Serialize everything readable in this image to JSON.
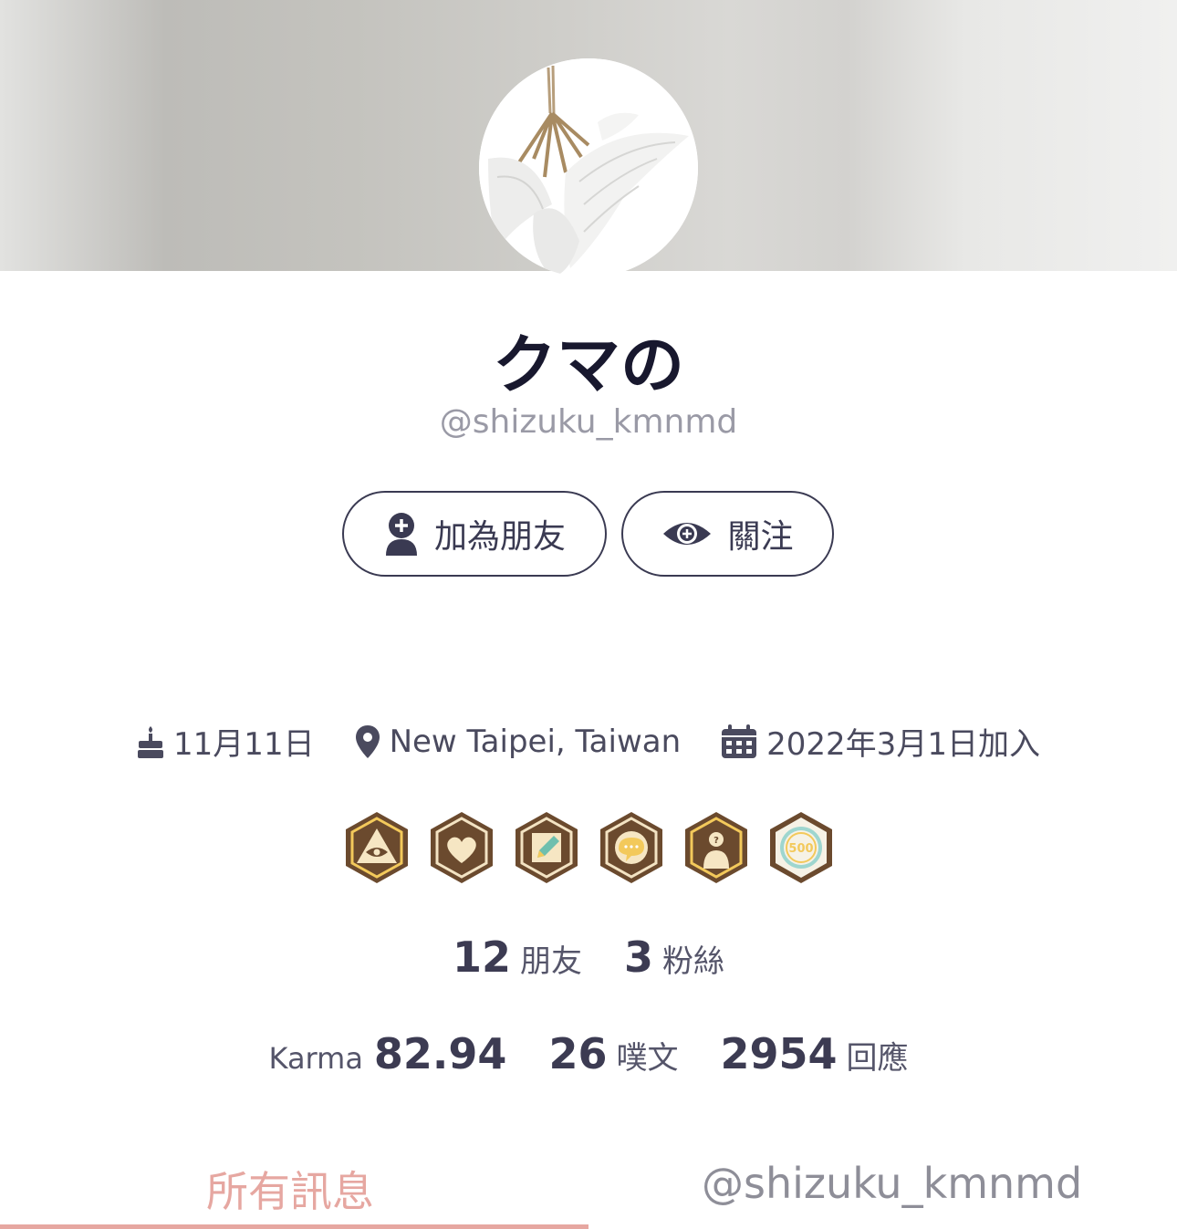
{
  "profile": {
    "display_name": "クマの",
    "handle": "@shizuku_kmnmd"
  },
  "actions": {
    "add_friend_label": "加為朋友",
    "follow_label": "關注"
  },
  "meta": {
    "birthday": "11月11日",
    "location": "New Taipei, Taiwan",
    "joined": "2022年3月1日加入"
  },
  "badges": [
    {
      "name": "eye-triangle-badge",
      "ring": "#f3c95b"
    },
    {
      "name": "heart-badge",
      "ring": "#f3e3c3"
    },
    {
      "name": "pencil-badge",
      "ring": "#f3e3c3"
    },
    {
      "name": "chat-badge",
      "ring": "#f3e3c3"
    },
    {
      "name": "anonymous-badge",
      "ring": "#f3c95b"
    },
    {
      "name": "500-badge",
      "ring": "#ffffff",
      "text": "500"
    }
  ],
  "social": {
    "friends_count": "12",
    "friends_label": "朋友",
    "fans_count": "3",
    "fans_label": "粉絲"
  },
  "activity": {
    "karma_label": "Karma",
    "karma_value": "82.94",
    "posts_count": "26",
    "posts_label": "噗文",
    "replies_count": "2954",
    "replies_label": "回應"
  },
  "tabs": {
    "all_label": "所有訊息",
    "user_label": "@shizuku_kmnmd"
  },
  "colors": {
    "accent": "#e6a7a1",
    "text_dark": "#3c3b52",
    "badge_brown": "#6b4a2e"
  }
}
